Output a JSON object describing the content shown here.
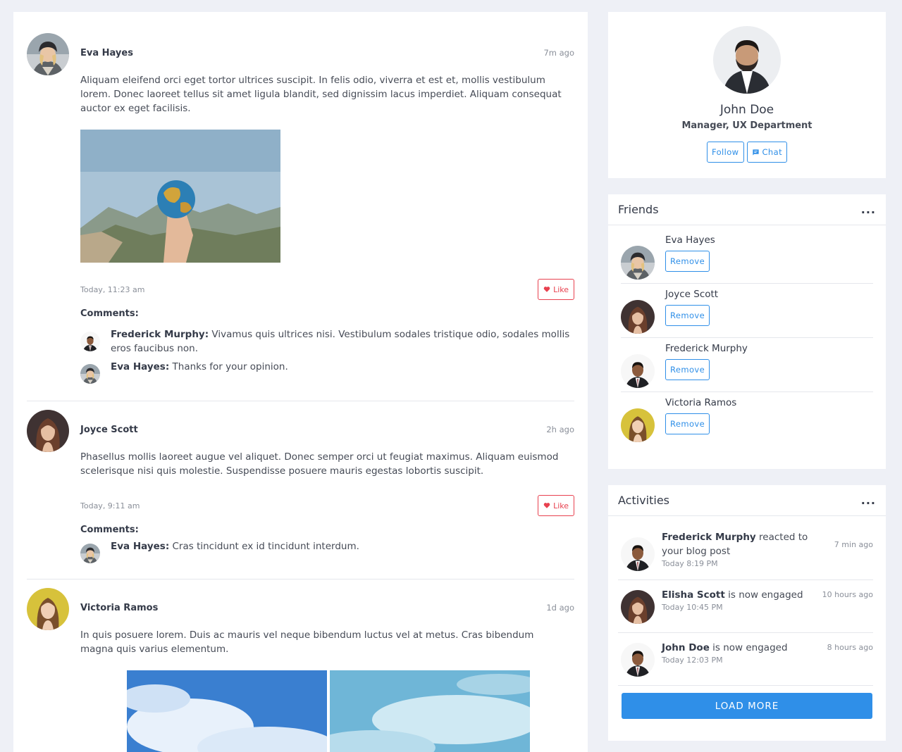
{
  "posts": [
    {
      "author": "Eva Hayes",
      "ago": "7m ago",
      "text": "Aliquam eleifend orci eget tortor ultrices suscipit. In felis odio, viverra et est et, mollis vestibulum lorem. Donec laoreet tellus sit amet ligula blandit, sed dignissim lacus imperdiet. Aliquam consequat auctor ex eget facilisis.",
      "stamp": "Today, 11:23 am",
      "like_label": "Like",
      "comments_title": "Comments:",
      "comments": [
        {
          "author": "Frederick Murphy:",
          "text": " Vivamus quis ultrices nisi. Vestibulum sodales tristique odio, sodales mollis eros faucibus non."
        },
        {
          "author": "Eva Hayes:",
          "text": " Thanks for your opinion."
        }
      ]
    },
    {
      "author": "Joyce Scott",
      "ago": "2h ago",
      "text": "Phasellus mollis laoreet augue vel aliquet. Donec semper orci ut feugiat maximus. Aliquam euismod scelerisque nisi quis molestie. Suspendisse posuere mauris egestas lobortis suscipit.",
      "stamp": "Today, 9:11 am",
      "like_label": "Like",
      "comments_title": "Comments:",
      "comments": [
        {
          "author": "Eva Hayes:",
          "text": " Cras tincidunt ex id tincidunt interdum."
        }
      ]
    },
    {
      "author": "Victoria Ramos",
      "ago": "1d ago",
      "text": "In quis posuere lorem. Duis ac mauris vel neque bibendum luctus vel at metus. Cras bibendum magna quis varius elementum."
    }
  ],
  "profile": {
    "name": "John Doe",
    "role": "Manager, UX Department",
    "follow_label": "Follow",
    "chat_label": "Chat"
  },
  "friends": {
    "title": "Friends",
    "menu": "...",
    "remove_label": "Remove",
    "items": [
      {
        "name": "Eva Hayes"
      },
      {
        "name": "Joyce Scott"
      },
      {
        "name": "Frederick Murphy"
      },
      {
        "name": "Victoria Ramos"
      }
    ]
  },
  "activities": {
    "title": "Activities",
    "menu": "...",
    "items": [
      {
        "name": "Frederick Murphy",
        "action": " reacted to your blog post",
        "when": "Today 8:19 PM",
        "ago": "7 min ago"
      },
      {
        "name": "Elisha Scott",
        "action": " is now engaged",
        "when": "Today 10:45 PM",
        "ago": "10 hours ago"
      },
      {
        "name": "John Doe",
        "action": " is now engaged",
        "when": "Today 12:03 PM",
        "ago": "8 hours ago"
      }
    ],
    "load_more": "LOAD MORE"
  },
  "colors": {
    "accent": "#2f8fe8",
    "like": "#e8414f",
    "background": "#eef0f6"
  }
}
